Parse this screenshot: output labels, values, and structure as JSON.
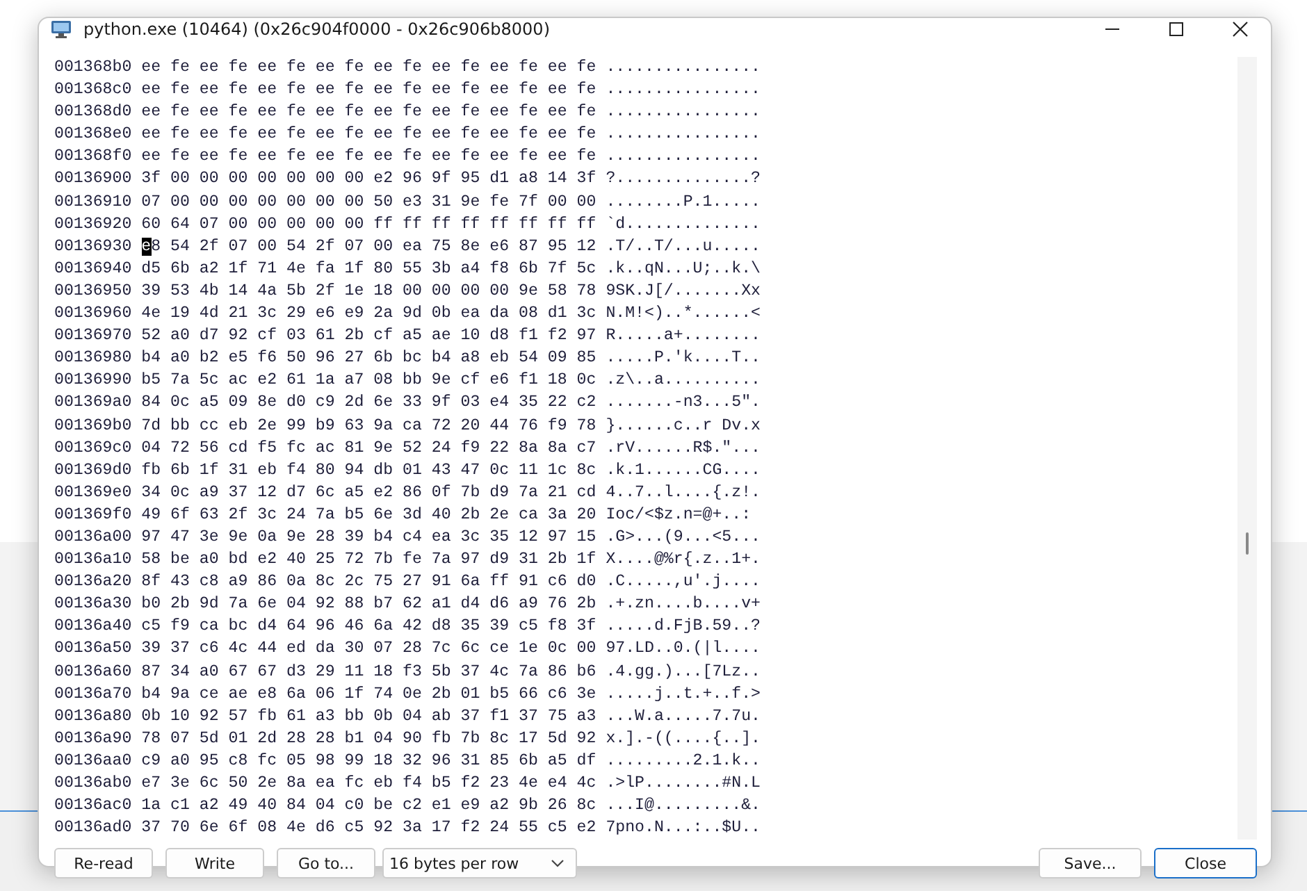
{
  "window": {
    "title": "python.exe (10464) (0x26c904f0000 - 0x26c906b8000)"
  },
  "rows": [
    {
      "address": "001368b0",
      "hex": "ee fe ee fe ee fe ee fe ee fe ee fe ee fe ee fe",
      "ascii": "................",
      "cursor": false
    },
    {
      "address": "001368c0",
      "hex": "ee fe ee fe ee fe ee fe ee fe ee fe ee fe ee fe",
      "ascii": "................",
      "cursor": false
    },
    {
      "address": "001368d0",
      "hex": "ee fe ee fe ee fe ee fe ee fe ee fe ee fe ee fe",
      "ascii": "................",
      "cursor": false
    },
    {
      "address": "001368e0",
      "hex": "ee fe ee fe ee fe ee fe ee fe ee fe ee fe ee fe",
      "ascii": "................",
      "cursor": false
    },
    {
      "address": "001368f0",
      "hex": "ee fe ee fe ee fe ee fe ee fe ee fe ee fe ee fe",
      "ascii": "................",
      "cursor": false
    },
    {
      "address": "00136900",
      "hex": "3f 00 00 00 00 00 00 00 e2 96 9f 95 d1 a8 14 3f",
      "ascii": "?..............?",
      "cursor": false
    },
    {
      "address": "00136910",
      "hex": "07 00 00 00 00 00 00 00 50 e3 31 9e fe 7f 00 00",
      "ascii": "........P.1.....",
      "cursor": false
    },
    {
      "address": "00136920",
      "hex": "60 64 07 00 00 00 00 00 ff ff ff ff ff ff ff ff",
      "ascii": "`d..............",
      "cursor": false
    },
    {
      "address": "00136930",
      "hex": "e8 54 2f 07 00 54 2f 07 00 ea 75 8e e6 87 95 12",
      "ascii": ".T/..T/...u.....",
      "cursor": true
    },
    {
      "address": "00136940",
      "hex": "d5 6b a2 1f 71 4e fa 1f 80 55 3b a4 f8 6b 7f 5c",
      "ascii": ".k..qN...U;..k.\\",
      "cursor": false
    },
    {
      "address": "00136950",
      "hex": "39 53 4b 14 4a 5b 2f 1e 18 00 00 00 00 9e 58 78",
      "ascii": "9SK.J[/.......Xx",
      "cursor": false
    },
    {
      "address": "00136960",
      "hex": "4e 19 4d 21 3c 29 e6 e9 2a 9d 0b ea da 08 d1 3c",
      "ascii": "N.M!<)..*......<",
      "cursor": false
    },
    {
      "address": "00136970",
      "hex": "52 a0 d7 92 cf 03 61 2b cf a5 ae 10 d8 f1 f2 97",
      "ascii": "R.....a+........",
      "cursor": false
    },
    {
      "address": "00136980",
      "hex": "b4 a0 b2 e5 f6 50 96 27 6b bc b4 a8 eb 54 09 85",
      "ascii": ".....P.'k....T..",
      "cursor": false
    },
    {
      "address": "00136990",
      "hex": "b5 7a 5c ac e2 61 1a a7 08 bb 9e cf e6 f1 18 0c",
      "ascii": ".z\\..a..........",
      "cursor": false
    },
    {
      "address": "001369a0",
      "hex": "84 0c a5 09 8e d0 c9 2d 6e 33 9f 03 e4 35 22 c2",
      "ascii": ".......-n3...5\".",
      "cursor": false
    },
    {
      "address": "001369b0",
      "hex": "7d bb cc eb 2e 99 b9 63 9a ca 72 20 44 76 f9 78",
      "ascii": "}......c..r Dv.x",
      "cursor": false
    },
    {
      "address": "001369c0",
      "hex": "04 72 56 cd f5 fc ac 81 9e 52 24 f9 22 8a 8a c7",
      "ascii": ".rV......R$.\"...",
      "cursor": false
    },
    {
      "address": "001369d0",
      "hex": "fb 6b 1f 31 eb f4 80 94 db 01 43 47 0c 11 1c 8c",
      "ascii": ".k.1......CG....",
      "cursor": false
    },
    {
      "address": "001369e0",
      "hex": "34 0c a9 37 12 d7 6c a5 e2 86 0f 7b d9 7a 21 cd",
      "ascii": "4..7..l....{.z!.",
      "cursor": false
    },
    {
      "address": "001369f0",
      "hex": "49 6f 63 2f 3c 24 7a b5 6e 3d 40 2b 2e ca 3a 20",
      "ascii": "Ioc/<$z.n=@+..: ",
      "cursor": false
    },
    {
      "address": "00136a00",
      "hex": "97 47 3e 9e 0a 9e 28 39 b4 c4 ea 3c 35 12 97 15",
      "ascii": ".G>...(9...<5...",
      "cursor": false
    },
    {
      "address": "00136a10",
      "hex": "58 be a0 bd e2 40 25 72 7b fe 7a 97 d9 31 2b 1f",
      "ascii": "X....@%r{.z..1+.",
      "cursor": false
    },
    {
      "address": "00136a20",
      "hex": "8f 43 c8 a9 86 0a 8c 2c 75 27 91 6a ff 91 c6 d0",
      "ascii": ".C.....,u'.j....",
      "cursor": false
    },
    {
      "address": "00136a30",
      "hex": "b0 2b 9d 7a 6e 04 92 88 b7 62 a1 d4 d6 a9 76 2b",
      "ascii": ".+.zn....b....v+",
      "cursor": false
    },
    {
      "address": "00136a40",
      "hex": "c5 f9 ca bc d4 64 96 46 6a 42 d8 35 39 c5 f8 3f",
      "ascii": ".....d.FjB.59..?",
      "cursor": false
    },
    {
      "address": "00136a50",
      "hex": "39 37 c6 4c 44 ed da 30 07 28 7c 6c ce 1e 0c 00",
      "ascii": "97.LD..0.(|l....",
      "cursor": false
    },
    {
      "address": "00136a60",
      "hex": "87 34 a0 67 67 d3 29 11 18 f3 5b 37 4c 7a 86 b6",
      "ascii": ".4.gg.)...[7Lz..",
      "cursor": false
    },
    {
      "address": "00136a70",
      "hex": "b4 9a ce ae e8 6a 06 1f 74 0e 2b 01 b5 66 c6 3e",
      "ascii": ".....j..t.+..f.>",
      "cursor": false
    },
    {
      "address": "00136a80",
      "hex": "0b 10 92 57 fb 61 a3 bb 0b 04 ab 37 f1 37 75 a3",
      "ascii": "...W.a.....7.7u.",
      "cursor": false
    },
    {
      "address": "00136a90",
      "hex": "78 07 5d 01 2d 28 28 b1 04 90 fb 7b 8c 17 5d 92",
      "ascii": "x.].-((....{..].",
      "cursor": false
    },
    {
      "address": "00136aa0",
      "hex": "c9 a0 95 c8 fc 05 98 99 18 32 96 31 85 6b a5 df",
      "ascii": ".........2.1.k..",
      "cursor": false
    },
    {
      "address": "00136ab0",
      "hex": "e7 3e 6c 50 2e 8a ea fc eb f4 b5 f2 23 4e e4 4c",
      "ascii": ".>lP........#N.L",
      "cursor": false
    },
    {
      "address": "00136ac0",
      "hex": "1a c1 a2 49 40 84 04 c0 be c2 e1 e9 a2 9b 26 8c",
      "ascii": "...I@.........&.",
      "cursor": false
    },
    {
      "address": "00136ad0",
      "hex": "37 70 6e 6f 08 4e d6 c5 92 3a 17 f2 24 55 c5 e2",
      "ascii": "7pno.N...:..$U..",
      "cursor": false
    }
  ],
  "buttons_left": [
    {
      "label": "Re-read"
    },
    {
      "label": "Write"
    },
    {
      "label": "Go to..."
    }
  ],
  "row_size": {
    "value": "16 bytes per row"
  },
  "buttons_right": [
    {
      "label": "Save...",
      "primary": false
    },
    {
      "label": "Close",
      "primary": true
    }
  ]
}
